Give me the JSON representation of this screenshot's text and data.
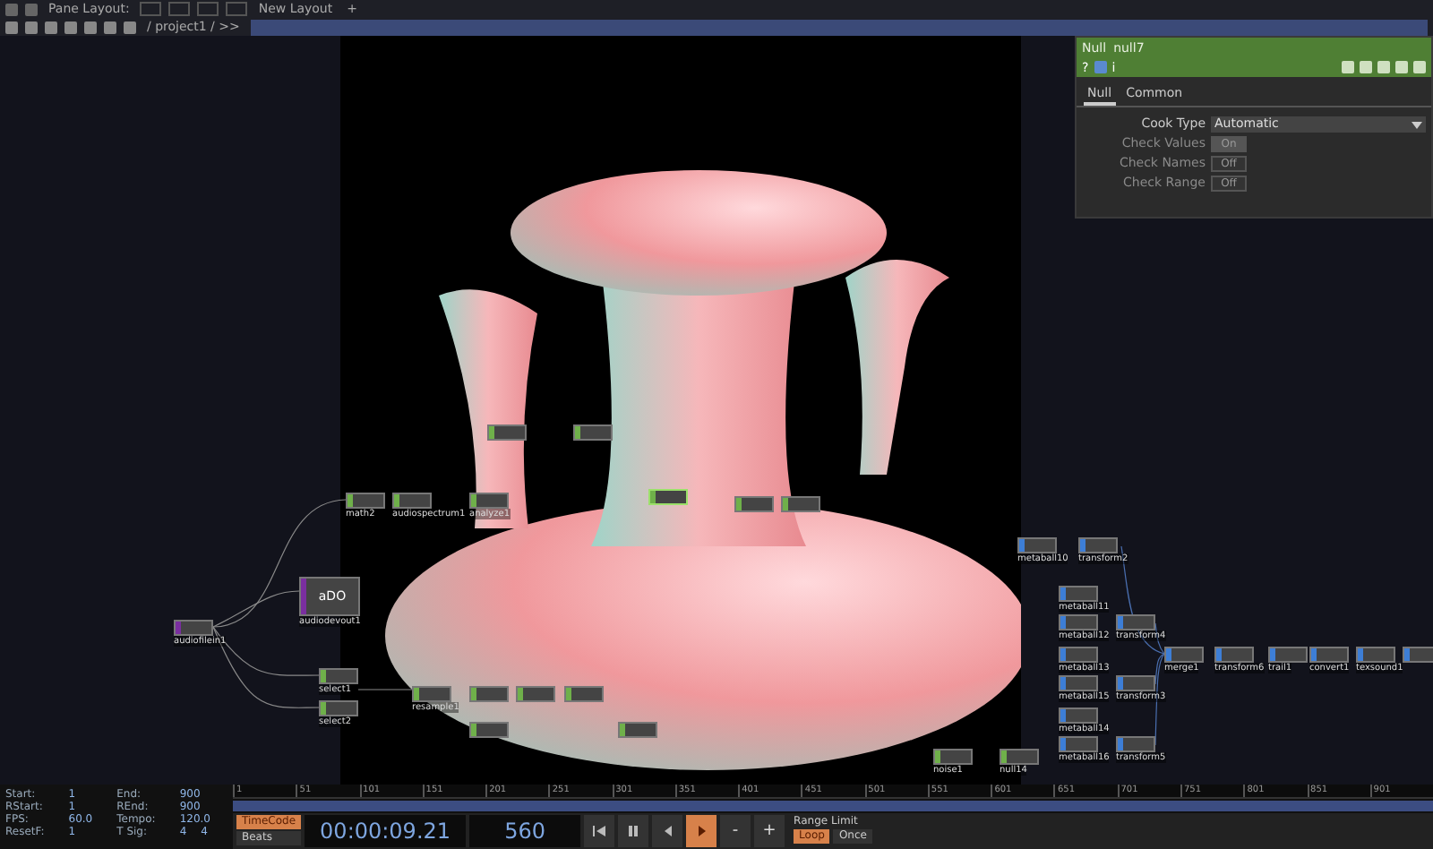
{
  "top_bar": {
    "pane_layout_label": "Pane Layout:",
    "new_layout": "New Layout",
    "add_label": "+"
  },
  "path_bar": {
    "path": "/ project1 / >>"
  },
  "parameters": {
    "op_type": "Null",
    "op_name": "null7",
    "help": "?",
    "info": "i",
    "tabs": [
      {
        "label": "Null",
        "selected": true
      },
      {
        "label": "Common",
        "selected": false
      }
    ],
    "params": [
      {
        "kind": "menu",
        "label": "Cook Type",
        "value": "Automatic",
        "disabled": false
      },
      {
        "kind": "toggle",
        "label": "Check Values",
        "value": "On",
        "on": true,
        "disabled": true
      },
      {
        "kind": "toggle",
        "label": "Check Names",
        "value": "Off",
        "on": false,
        "disabled": true
      },
      {
        "kind": "toggle",
        "label": "Check Range",
        "value": "Off",
        "on": false,
        "disabled": true
      }
    ]
  },
  "nodes": [
    {
      "label": "audiofilein1",
      "color": "#7a2ea0",
      "selected": false
    },
    {
      "label": "audiodevout1",
      "thumb_text": "aDO",
      "color": "#7a2ea0",
      "selected": false
    },
    {
      "label": "math2",
      "color": "#6fb04a",
      "selected": false
    },
    {
      "label": "audiospectrum1",
      "color": "#6fb04a",
      "selected": false
    },
    {
      "label": "analyze1",
      "color": "#6fb04a",
      "selected": false
    },
    {
      "label": "select1",
      "color": "#6fb04a",
      "selected": false
    },
    {
      "label": "select2",
      "color": "#6fb04a",
      "selected": false
    },
    {
      "label": "resample1",
      "color": "#6fb04a",
      "selected": false
    },
    {
      "color": "#6fb04a",
      "selected": false
    },
    {
      "color": "#6fb04a",
      "selected": false
    },
    {
      "color": "#6fb04a",
      "selected": true
    },
    {
      "color": "#6fb04a",
      "selected": false
    },
    {
      "color": "#6fb04a",
      "selected": false
    },
    {
      "color": "#6fb04a",
      "selected": false
    },
    {
      "color": "#6fb04a",
      "selected": false
    },
    {
      "color": "#6fb04a",
      "selected": false
    },
    {
      "color": "#6fb04a",
      "selected": false
    },
    {
      "color": "#6fb04a",
      "selected": false
    },
    {
      "label": "metaball10",
      "color": "#3d7ed6",
      "selected": false
    },
    {
      "label": "transform2",
      "color": "#3d7ed6",
      "selected": false
    },
    {
      "label": "metaball11",
      "color": "#3d7ed6",
      "selected": false
    },
    {
      "label": "metaball12",
      "color": "#3d7ed6",
      "selected": false
    },
    {
      "label": "transform4",
      "color": "#3d7ed6",
      "selected": false
    },
    {
      "label": "metaball13",
      "color": "#3d7ed6",
      "selected": false
    },
    {
      "label": "metaball15",
      "color": "#3d7ed6",
      "selected": false
    },
    {
      "label": "transform3",
      "color": "#3d7ed6",
      "selected": false
    },
    {
      "label": "metaball14",
      "color": "#3d7ed6",
      "selected": false
    },
    {
      "label": "metaball16",
      "color": "#3d7ed6",
      "selected": false
    },
    {
      "label": "transform5",
      "color": "#3d7ed6",
      "selected": false
    },
    {
      "label": "merge1",
      "color": "#3d7ed6",
      "selected": false
    },
    {
      "label": "transform6",
      "color": "#3d7ed6",
      "selected": false
    },
    {
      "label": "trail1",
      "color": "#3d7ed6",
      "selected": false
    },
    {
      "label": "convert1",
      "color": "#3d7ed6",
      "selected": false
    },
    {
      "label": "texsound1",
      "color": "#3d7ed6",
      "selected": false
    },
    {
      "color": "#3d7ed6",
      "selected": false
    },
    {
      "label": "noise1",
      "color": "#6fb04a",
      "selected": false
    },
    {
      "label": "null14",
      "color": "#6fb04a",
      "selected": false
    }
  ],
  "timeline": {
    "info": [
      {
        "label": "Start:",
        "values": [
          "1"
        ]
      },
      {
        "label": "End:",
        "values": [
          "900"
        ]
      },
      {
        "label": "RStart:",
        "values": [
          "1"
        ]
      },
      {
        "label": "REnd:",
        "values": [
          "900"
        ]
      },
      {
        "label": "FPS:",
        "values": [
          "60.0"
        ]
      },
      {
        "label": "Tempo:",
        "values": [
          "120.0"
        ]
      },
      {
        "label": "ResetF:",
        "values": [
          "1"
        ]
      },
      {
        "label": "T Sig:",
        "values": [
          "4",
          "4"
        ]
      }
    ],
    "ruler": [
      "1",
      "51",
      "101",
      "151",
      "201",
      "251",
      "301",
      "351",
      "401",
      "451",
      "501",
      "551",
      "601",
      "651",
      "701",
      "751",
      "801",
      "851",
      "901"
    ],
    "time_modes": [
      {
        "label": "TimeCode",
        "selected": true
      },
      {
        "label": "Beats",
        "selected": false
      }
    ],
    "timecode": "00:00:09.21",
    "frame": "560",
    "transport": [
      {
        "kind": "skip-start",
        "selected": false
      },
      {
        "kind": "pause",
        "selected": false
      },
      {
        "kind": "step-back",
        "selected": false
      },
      {
        "kind": "play",
        "selected": true
      },
      {
        "kind": "text",
        "label": "-",
        "selected": false
      },
      {
        "kind": "text",
        "label": "+",
        "selected": false
      }
    ],
    "range_limit": {
      "label": "Range Limit",
      "options": [
        {
          "label": "Loop",
          "selected": true
        },
        {
          "label": "Once",
          "selected": false
        }
      ]
    }
  }
}
